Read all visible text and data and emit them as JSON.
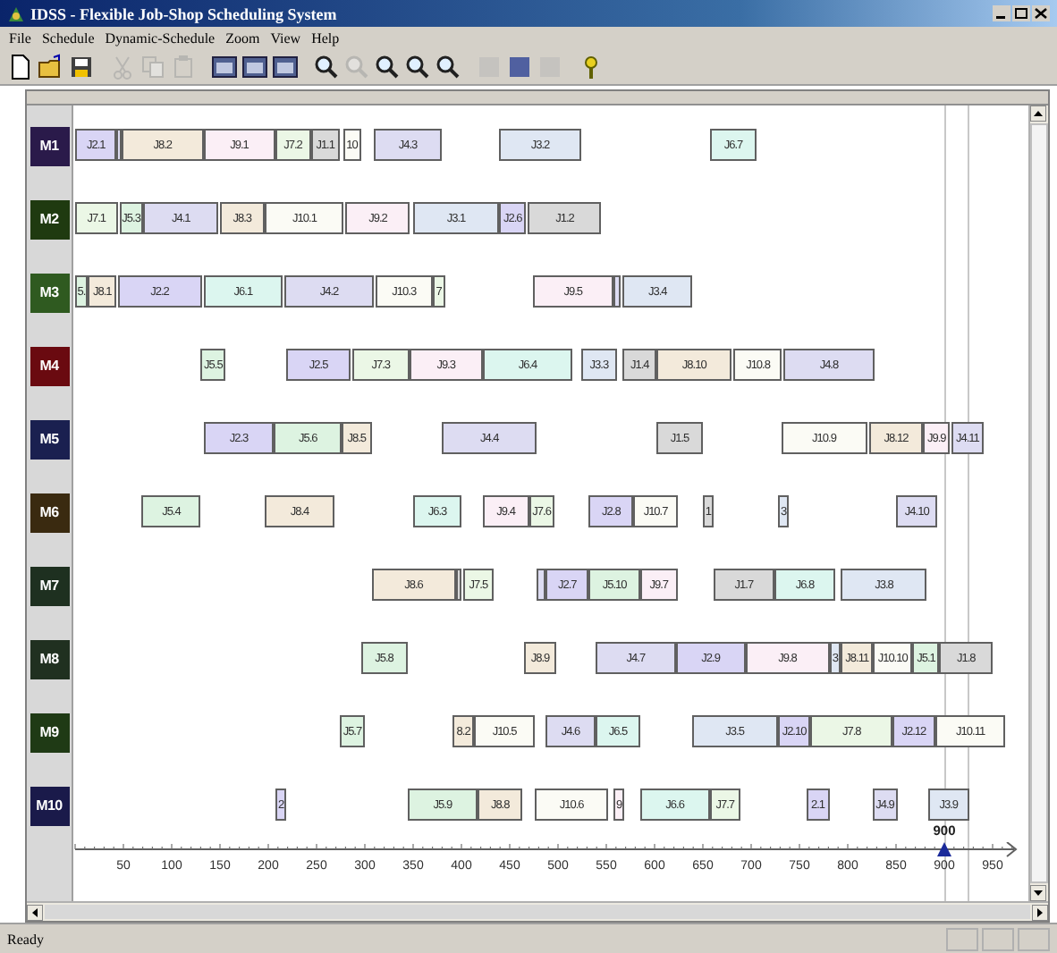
{
  "window": {
    "title": "IDSS - Flexible Job-Shop Scheduling System"
  },
  "menu": [
    "File",
    "Schedule",
    "Dynamic-Schedule",
    "Zoom",
    "View",
    "Help"
  ],
  "toolbar": [
    {
      "kind": "new",
      "disabled": false
    },
    {
      "kind": "open",
      "disabled": false
    },
    {
      "kind": "save",
      "disabled": false
    },
    {
      "kind": "sep"
    },
    {
      "kind": "cut",
      "disabled": true
    },
    {
      "kind": "copy",
      "disabled": true
    },
    {
      "kind": "paste",
      "disabled": true
    },
    {
      "kind": "sep"
    },
    {
      "kind": "window",
      "disabled": false
    },
    {
      "kind": "window",
      "disabled": false
    },
    {
      "kind": "window",
      "disabled": false
    },
    {
      "kind": "sep"
    },
    {
      "kind": "zoom",
      "disabled": false
    },
    {
      "kind": "zoom",
      "disabled": true
    },
    {
      "kind": "zoom",
      "disabled": false
    },
    {
      "kind": "zoom",
      "disabled": false
    },
    {
      "kind": "zoom",
      "disabled": false
    },
    {
      "kind": "sep"
    },
    {
      "kind": "block",
      "disabled": true
    },
    {
      "kind": "block",
      "disabled": false
    },
    {
      "kind": "block",
      "disabled": true
    },
    {
      "kind": "sep"
    },
    {
      "kind": "help",
      "disabled": false
    }
  ],
  "machines": [
    {
      "label": "M1",
      "color": "#2a1a4a",
      "bars": [
        {
          "label": "J2.1",
          "color": "#d9d5f5"
        },
        {
          "color": "#dddcf2"
        },
        {
          "label": "J8.2",
          "color": "#f3eadb"
        },
        {
          "label": "J9.1",
          "color": "#fbeff6"
        },
        {
          "label": "J7.2",
          "color": "#ebf7e6"
        },
        {
          "label": "J1.1",
          "color": "#d9d9d9"
        },
        {
          "label": "10",
          "color": "#fbfbf5"
        },
        {
          "label": "J4.3",
          "color": "#dddcf2"
        },
        {
          "label": "J3.2",
          "color": "#dfe7f3"
        },
        {
          "label": "J6.7",
          "color": "#dcf6ef"
        }
      ]
    },
    {
      "label": "M2",
      "color": "#1f3a10",
      "bars": [
        {
          "label": "J7.1",
          "color": "#ebf7e6"
        },
        {
          "label": "J5.3",
          "color": "#ddf3e1"
        },
        {
          "label": "J4.1",
          "color": "#dddcf2"
        },
        {
          "label": "J8.3",
          "color": "#f3eadb"
        },
        {
          "label": "J10.1",
          "color": "#fbfbf5"
        },
        {
          "label": "J9.2",
          "color": "#fbeff6"
        },
        {
          "label": "J3.1",
          "color": "#dfe7f3"
        },
        {
          "label": "J2.6",
          "color": "#d9d5f5"
        },
        {
          "label": "J1.2",
          "color": "#d9d9d9"
        }
      ]
    },
    {
      "label": "M3",
      "color": "#2f5a20",
      "bars": [
        {
          "label": "5.",
          "color": "#ddf3e1"
        },
        {
          "label": "J8.1",
          "color": "#f3eadb"
        },
        {
          "label": "J2.2",
          "color": "#d9d5f5"
        },
        {
          "label": "J6.1",
          "color": "#dcf6ef"
        },
        {
          "label": "J4.2",
          "color": "#dddcf2"
        },
        {
          "label": "J10.3",
          "color": "#fbfbf5"
        },
        {
          "label": "7",
          "color": "#ebf7e6"
        },
        {
          "label": "J9.5",
          "color": "#fbeff6"
        },
        {
          "color": "#dddcf2"
        },
        {
          "label": "J3.4",
          "color": "#dfe7f3"
        }
      ]
    },
    {
      "label": "M4",
      "color": "#6a0a10",
      "bars": [
        {
          "label": "J5.5",
          "color": "#ddf3e1"
        },
        {
          "label": "J2.5",
          "color": "#d9d5f5"
        },
        {
          "label": "J7.3",
          "color": "#ebf7e6"
        },
        {
          "label": "J9.3",
          "color": "#fbeff6"
        },
        {
          "label": "J6.4",
          "color": "#dcf6ef"
        },
        {
          "label": "J3.3",
          "color": "#dfe7f3"
        },
        {
          "label": "J1.4",
          "color": "#d9d9d9"
        },
        {
          "label": "J8.10",
          "color": "#f3eadb"
        },
        {
          "label": "J10.8",
          "color": "#fbfbf5"
        },
        {
          "label": "J4.8",
          "color": "#dddcf2"
        }
      ]
    },
    {
      "label": "M5",
      "color": "#1a2050",
      "bars": [
        {
          "label": "J2.3",
          "color": "#d9d5f5"
        },
        {
          "label": "J5.6",
          "color": "#ddf3e1"
        },
        {
          "label": "J8.5",
          "color": "#f3eadb"
        },
        {
          "label": "J4.4",
          "color": "#dddcf2"
        },
        {
          "label": "J1.5",
          "color": "#d9d9d9"
        },
        {
          "label": "J10.9",
          "color": "#fbfbf5"
        },
        {
          "label": "J8.12",
          "color": "#f3eadb"
        },
        {
          "label": "J9.9",
          "color": "#fbeff6"
        },
        {
          "label": "J4.11",
          "color": "#dddcf2"
        }
      ]
    },
    {
      "label": "M6",
      "color": "#3a2a10",
      "bars": [
        {
          "label": "J5.4",
          "color": "#ddf3e1"
        },
        {
          "label": "J8.4",
          "color": "#f3eadb"
        },
        {
          "label": "J6.3",
          "color": "#dcf6ef"
        },
        {
          "label": "J9.4",
          "color": "#fbeff6"
        },
        {
          "label": "J7.6",
          "color": "#ebf7e6"
        },
        {
          "label": "J2.8",
          "color": "#d9d5f5"
        },
        {
          "label": "J10.7",
          "color": "#fbfbf5"
        },
        {
          "label": "1",
          "color": "#d9d9d9"
        },
        {
          "label": "3",
          "color": "#dfe7f3"
        },
        {
          "label": "J4.10",
          "color": "#dddcf2"
        }
      ]
    },
    {
      "label": "M7",
      "color": "#1e3020",
      "bars": [
        {
          "label": "J8.6",
          "color": "#f3eadb"
        },
        {
          "color": "#d9d9d9"
        },
        {
          "label": "J7.5",
          "color": "#ebf7e6"
        },
        {
          "color": "#dddcf2"
        },
        {
          "label": "J2.7",
          "color": "#d9d5f5"
        },
        {
          "label": "J5.10",
          "color": "#ddf3e1"
        },
        {
          "label": "J9.7",
          "color": "#fbeff6"
        },
        {
          "label": "J1.7",
          "color": "#d9d9d9"
        },
        {
          "label": "J6.8",
          "color": "#dcf6ef"
        },
        {
          "label": "J3.8",
          "color": "#dfe7f3"
        }
      ]
    },
    {
      "label": "M8",
      "color": "#203020",
      "bars": [
        {
          "label": "J5.8",
          "color": "#ddf3e1"
        },
        {
          "label": "J8.9",
          "color": "#f3eadb"
        },
        {
          "label": "J4.7",
          "color": "#dddcf2"
        },
        {
          "label": "J2.9",
          "color": "#d9d5f5"
        },
        {
          "label": "J9.8",
          "color": "#fbeff6"
        },
        {
          "label": "3",
          "color": "#dfe7f3"
        },
        {
          "label": "J8.11",
          "color": "#f3eadb"
        },
        {
          "label": "J10.10",
          "color": "#fbfbf5"
        },
        {
          "label": "J5.1",
          "color": "#ddf3e1"
        },
        {
          "label": "J1.8",
          "color": "#d9d9d9"
        }
      ]
    },
    {
      "label": "M9",
      "color": "#1f3a15",
      "bars": [
        {
          "label": "J5.7",
          "color": "#ddf3e1"
        },
        {
          "label": "8.2",
          "color": "#f3eadb"
        },
        {
          "label": "J10.5",
          "color": "#fbfbf5"
        },
        {
          "label": "J4.6",
          "color": "#dddcf2"
        },
        {
          "label": "J6.5",
          "color": "#dcf6ef"
        },
        {
          "label": "J3.5",
          "color": "#dfe7f3"
        },
        {
          "label": "J2.10",
          "color": "#d9d5f5"
        },
        {
          "label": "J7.8",
          "color": "#ebf7e6"
        },
        {
          "label": "J2.12",
          "color": "#d9d5f5"
        },
        {
          "label": "J10.11",
          "color": "#fbfbf5"
        }
      ]
    },
    {
      "label": "M10",
      "color": "#1a1a4a",
      "bars": [
        {
          "label": "2",
          "color": "#d9d5f5"
        },
        {
          "label": "J5.9",
          "color": "#ddf3e1"
        },
        {
          "label": "J8.8",
          "color": "#f3eadb"
        },
        {
          "label": "J10.6",
          "color": "#fbfbf5"
        },
        {
          "label": "9",
          "color": "#fbeff6"
        },
        {
          "label": "J6.6",
          "color": "#dcf6ef"
        },
        {
          "label": "J7.7",
          "color": "#ebf7e6"
        },
        {
          "label": "2.1",
          "color": "#d9d5f5"
        },
        {
          "label": "J4.9",
          "color": "#dddcf2"
        },
        {
          "label": "J3.9",
          "color": "#dfe7f3"
        }
      ]
    }
  ],
  "axis": {
    "ticks": [
      "50",
      "100",
      "150",
      "200",
      "250",
      "300",
      "350",
      "400",
      "450",
      "500",
      "550",
      "600",
      "650",
      "700",
      "750",
      "800",
      "850",
      "900",
      "950"
    ],
    "marker": "900"
  },
  "status_bar": {
    "text": "Ready"
  }
}
